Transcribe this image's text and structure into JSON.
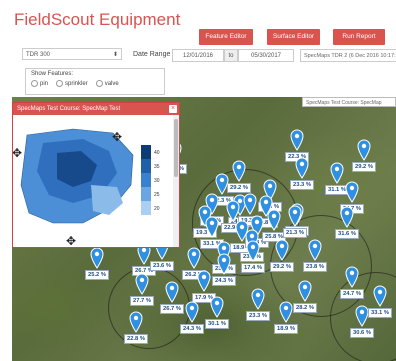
{
  "app": {
    "title": "FieldScout Equipment"
  },
  "toolbar": {
    "feature_editor": "Feature Editor",
    "surface_editor": "Surface Editor",
    "run_report": "Run Report"
  },
  "filters": {
    "device": "TDR 300",
    "date_range_label": "Date Range",
    "start_date": "12/01/2016",
    "to_label": "to",
    "end_date": "05/30/2017",
    "dataset": "SpecMaps TDR 2 (6 Dec 2016 10:17:14"
  },
  "features": {
    "label": "Show Features:",
    "options": [
      "pin",
      "sprinkler",
      "valve"
    ]
  },
  "map": {
    "header": "SpecMaps Test Course: SpecMap"
  },
  "panel": {
    "title": "SpecMaps Test Course: SpecMap Test",
    "close": "×",
    "legend": [
      "40",
      "35",
      "30",
      "25",
      "20"
    ]
  },
  "readings": [
    "31.6 %",
    "22.3 %",
    "29.2 %",
    "29.2 %",
    "23.3 %",
    "31.1 %",
    "24.7 %",
    "22.3 %",
    "23.8 %",
    "24.7 %",
    "24.3 %",
    "19.3 %",
    "22.9 %",
    "19.3 %",
    "22.8 %",
    "29.7 %",
    "33.1 %",
    "18.9 %",
    "20.3 %",
    "25.8 %",
    "23.7 %",
    "21.3 %",
    "31.6 %",
    "25.2 %",
    "26.7 %",
    "23.6 %",
    "26.2 %",
    "23.3 %",
    "17.4 %",
    "29.2 %",
    "23.8 %",
    "24.3 %",
    "27.7 %",
    "17.9 %",
    "26.7 %",
    "28.2 %",
    "24.7 %",
    "23.3 %",
    "22.8 %",
    "24.3 %",
    "30.1 %",
    "30.6 %",
    "33.1 %",
    "18.9 %"
  ],
  "colors": {
    "accent": "#d9534f",
    "pin": "#2f8fe0"
  }
}
